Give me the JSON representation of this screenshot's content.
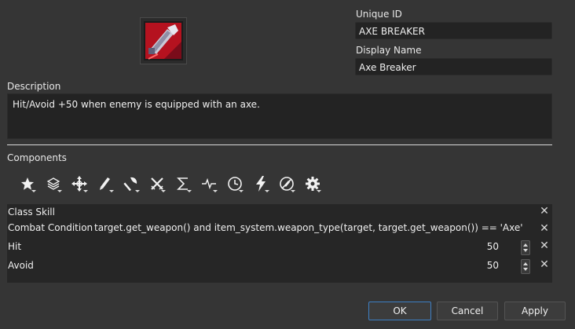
{
  "unique_id": {
    "label": "Unique ID",
    "value": "AXE BREAKER"
  },
  "display_name": {
    "label": "Display Name",
    "value": "Axe Breaker"
  },
  "description": {
    "label": "Description",
    "value": "Hit/Avoid +50 when enemy is equipped with an axe."
  },
  "components": {
    "label": "Components",
    "toolbar": [
      {
        "icon": "star-icon"
      },
      {
        "icon": "layers-icon"
      },
      {
        "icon": "move-icon"
      },
      {
        "icon": "pen-icon"
      },
      {
        "icon": "axe-icon"
      },
      {
        "icon": "crossed-swords-icon"
      },
      {
        "icon": "sigma-icon"
      },
      {
        "icon": "pulse-icon"
      },
      {
        "icon": "clock-icon"
      },
      {
        "icon": "lightning-icon"
      },
      {
        "icon": "no-weapon-icon"
      },
      {
        "icon": "gear-icon"
      }
    ],
    "rows": [
      {
        "name": "Class Skill",
        "expr": "",
        "value": ""
      },
      {
        "name": "Combat Condition",
        "expr": "target.get_weapon() and item_system.weapon_type(target, target.get_weapon()) == 'Axe'",
        "value": ""
      },
      {
        "name": "Hit",
        "expr": "",
        "value": "50"
      },
      {
        "name": "Avoid",
        "expr": "",
        "value": "50"
      }
    ]
  },
  "buttons": {
    "ok": "OK",
    "cancel": "Cancel",
    "apply": "Apply"
  },
  "colors": {
    "accent": "#3d7fc4",
    "icon_red": "#c8102e"
  }
}
